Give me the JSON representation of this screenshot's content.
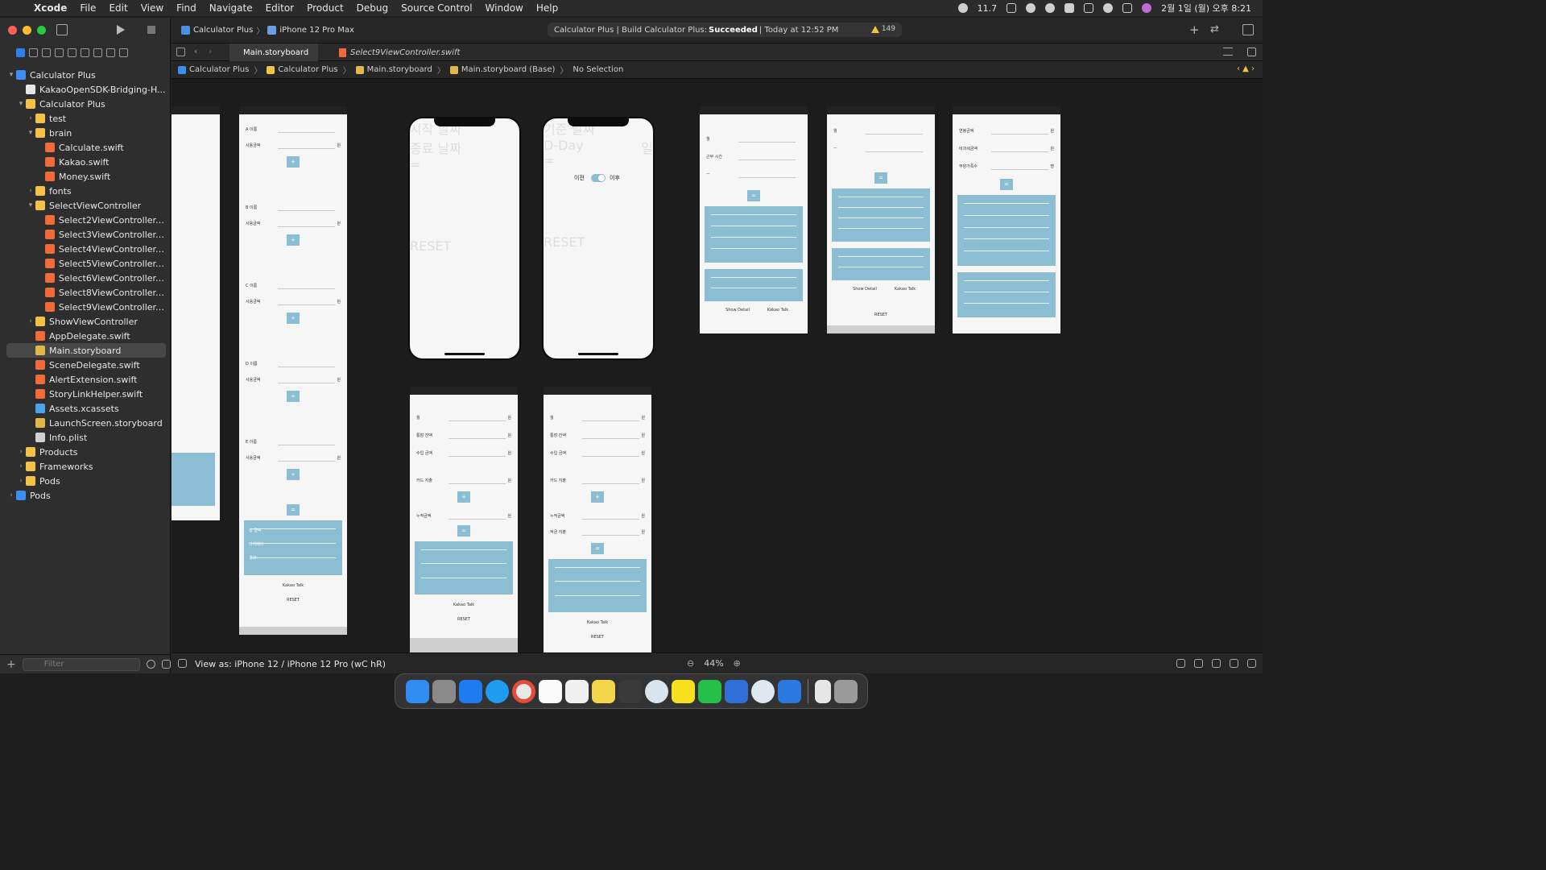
{
  "menubar": {
    "app": "Xcode",
    "items": [
      "File",
      "Edit",
      "View",
      "Find",
      "Navigate",
      "Editor",
      "Product",
      "Debug",
      "Source Control",
      "Window",
      "Help"
    ],
    "battery": "11.7",
    "clock": "2월 1일 (월) 오후 8:21"
  },
  "toolbar": {
    "scheme": "Calculator Plus",
    "device": "iPhone 12 Pro Max",
    "status_project": "Calculator Plus | Build Calculator Plus:",
    "status_result": "Succeeded",
    "status_time": "| Today at 12:52 PM",
    "warnings": "149"
  },
  "tabs": [
    {
      "label": "Main.storyboard",
      "active": true
    },
    {
      "label": "Select9ViewController.swift",
      "active": false
    }
  ],
  "jumpbar": [
    "Calculator Plus",
    "Calculator Plus",
    "Main.storyboard",
    "Main.storyboard (Base)",
    "No Selection"
  ],
  "navigator": {
    "filter_placeholder": "Filter",
    "items": [
      {
        "label": "Calculator Plus",
        "type": "proj",
        "depth": 0,
        "disclosure": "open"
      },
      {
        "label": "KakaoOpenSDK-Bridging-H...",
        "type": "h",
        "depth": 1,
        "disclosure": ""
      },
      {
        "label": "Calculator Plus",
        "type": "folder",
        "depth": 1,
        "disclosure": "open"
      },
      {
        "label": "test",
        "type": "folder",
        "depth": 2,
        "disclosure": "closed"
      },
      {
        "label": "brain",
        "type": "folder",
        "depth": 2,
        "disclosure": "open"
      },
      {
        "label": "Calculate.swift",
        "type": "swift",
        "depth": 3,
        "disclosure": ""
      },
      {
        "label": "Kakao.swift",
        "type": "swift",
        "depth": 3,
        "disclosure": ""
      },
      {
        "label": "Money.swift",
        "type": "swift",
        "depth": 3,
        "disclosure": ""
      },
      {
        "label": "fonts",
        "type": "folder",
        "depth": 2,
        "disclosure": "closed"
      },
      {
        "label": "SelectViewController",
        "type": "folder",
        "depth": 2,
        "disclosure": "open"
      },
      {
        "label": "Select2ViewController....",
        "type": "swift",
        "depth": 3,
        "disclosure": ""
      },
      {
        "label": "Select3ViewController....",
        "type": "swift",
        "depth": 3,
        "disclosure": ""
      },
      {
        "label": "Select4ViewController....",
        "type": "swift",
        "depth": 3,
        "disclosure": ""
      },
      {
        "label": "Select5ViewController....",
        "type": "swift",
        "depth": 3,
        "disclosure": ""
      },
      {
        "label": "Select6ViewController....",
        "type": "swift",
        "depth": 3,
        "disclosure": ""
      },
      {
        "label": "Select8ViewController....",
        "type": "swift",
        "depth": 3,
        "disclosure": ""
      },
      {
        "label": "Select9ViewController....",
        "type": "swift",
        "depth": 3,
        "disclosure": ""
      },
      {
        "label": "ShowViewController",
        "type": "folder",
        "depth": 2,
        "disclosure": "closed"
      },
      {
        "label": "AppDelegate.swift",
        "type": "swift",
        "depth": 2,
        "disclosure": ""
      },
      {
        "label": "Main.storyboard",
        "type": "sb",
        "depth": 2,
        "disclosure": "",
        "selected": true
      },
      {
        "label": "SceneDelegate.swift",
        "type": "swift",
        "depth": 2,
        "disclosure": ""
      },
      {
        "label": "AlertExtension.swift",
        "type": "swift",
        "depth": 2,
        "disclosure": ""
      },
      {
        "label": "StoryLinkHelper.swift",
        "type": "swift",
        "depth": 2,
        "disclosure": ""
      },
      {
        "label": "Assets.xcassets",
        "type": "xc",
        "depth": 2,
        "disclosure": ""
      },
      {
        "label": "LaunchScreen.storyboard",
        "type": "sb",
        "depth": 2,
        "disclosure": ""
      },
      {
        "label": "Info.plist",
        "type": "plist",
        "depth": 2,
        "disclosure": ""
      },
      {
        "label": "Products",
        "type": "folder",
        "depth": 1,
        "disclosure": "closed"
      },
      {
        "label": "Frameworks",
        "type": "folder",
        "depth": 1,
        "disclosure": "closed"
      },
      {
        "label": "Pods",
        "type": "folder",
        "depth": 1,
        "disclosure": "closed"
      },
      {
        "label": "Pods",
        "type": "proj",
        "depth": 0,
        "disclosure": "closed"
      }
    ]
  },
  "canvas": {
    "eq": "=",
    "plus": "+",
    "reset": "RESET",
    "kakao": "Kakao Talk",
    "show_detail": "Show Detail",
    "vc2_fields": [
      "A 이름",
      "사용금액",
      "B 이름",
      "사용금액",
      "C 이름",
      "사용금액",
      "D 이름",
      "사용금액",
      "E 이름",
      "사용금액"
    ],
    "vc2_results": [
      "총 금액",
      "더치페이",
      "결과"
    ],
    "phone1_fields": [
      "시작 날짜",
      "종료 날짜"
    ],
    "phone2_fields": [
      "기준 날짜",
      "D-Day"
    ],
    "phone2_day_unit": "일",
    "toggle_before": "이전",
    "toggle_after": "이후",
    "vc5_fields": [
      "월",
      "근무 시간",
      "ㅡ"
    ],
    "vc6_fields": [
      "월",
      "ㅡ"
    ],
    "vc7_fields": [
      "연봉금액",
      "비과세금액",
      "부양가족수"
    ],
    "vc7_unit": "명",
    "vc8_fields": [
      "월",
      "통장 잔액",
      "수입 금액",
      "카드 지출",
      "누적금액"
    ],
    "vc9_fields": [
      "월",
      "통장 잔액",
      "수입 금액",
      "카드 지출",
      "누적금액",
      "적금 지출"
    ],
    "won": "원"
  },
  "bottombar": {
    "view_as": "View as: iPhone 12 / iPhone 12 Pro (wC hR)",
    "zoom": "44%"
  }
}
